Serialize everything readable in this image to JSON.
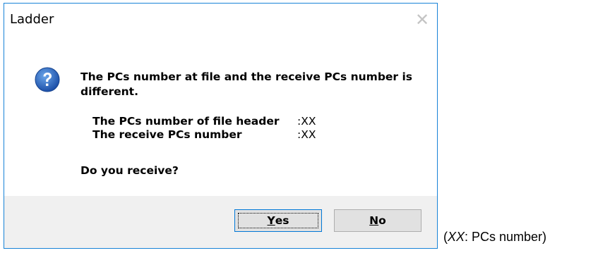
{
  "dialog": {
    "title": "Ladder",
    "close_glyph": "✕",
    "icon": "question-icon",
    "message_line1": "The PCs number at file and the receive PCs number is",
    "message_line2": "different.",
    "details": [
      {
        "label": "The PCs number of file header",
        "value": ":XX"
      },
      {
        "label": "The receive PCs number",
        "value": ":XX"
      }
    ],
    "question": "Do you receive?",
    "buttons": {
      "yes": {
        "accel": "Y",
        "rest": "es"
      },
      "no": {
        "accel": "N",
        "rest": "o"
      }
    }
  },
  "footnote": {
    "open": "(",
    "code": "XX",
    "rest": ": PCs number)"
  },
  "colors": {
    "border": "#1883d7",
    "footer_bg": "#f0f0f0",
    "button_bg": "#e1e1e1",
    "icon_blue": "#1c5fb8"
  }
}
